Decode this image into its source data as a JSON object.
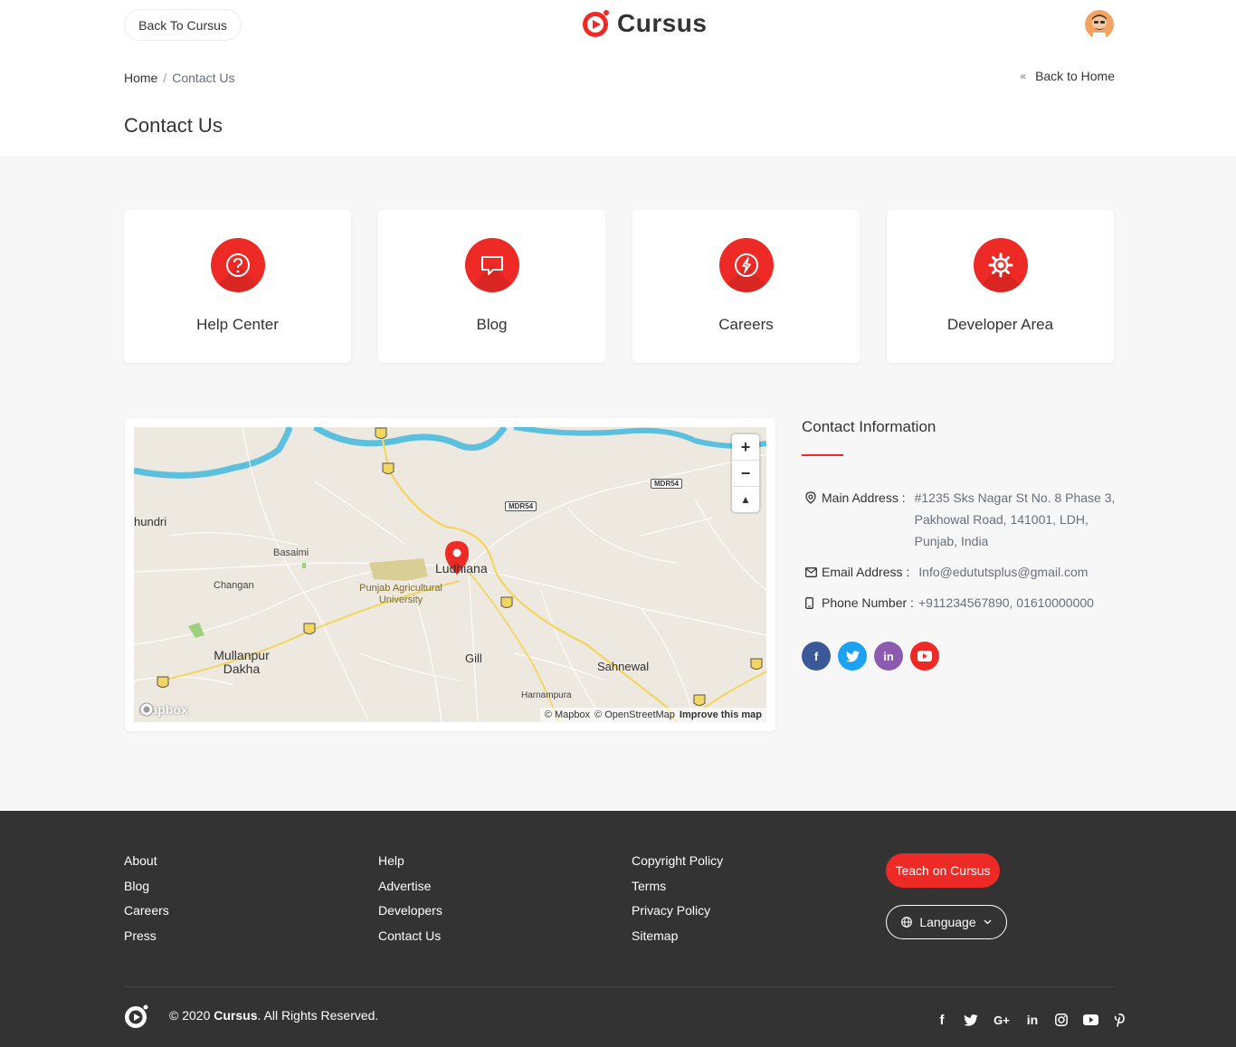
{
  "header": {
    "back_label": "Back To Cursus",
    "logo_text": "Cursus"
  },
  "breadcrumb": {
    "home": "Home",
    "separator": "/",
    "current": "Contact Us"
  },
  "back_home": {
    "arrows": "«",
    "label": "Back to Home"
  },
  "page_title": "Contact Us",
  "cards": [
    {
      "label": "Help Center",
      "icon": "question-icon"
    },
    {
      "label": "Blog",
      "icon": "comment-icon"
    },
    {
      "label": "Careers",
      "icon": "lightning-icon"
    },
    {
      "label": "Developer Area",
      "icon": "gear-icon"
    }
  ],
  "map": {
    "labels": {
      "ludhiana": "Ludhiana",
      "hundri": "hundri",
      "basaimi": "Basaimi",
      "changan": "Changan",
      "university": "Punjab Agricultural University",
      "mullanpur": "Mullanpur Dakha",
      "gill": "Gill",
      "sahnewal": "Sahnewal",
      "harnampura": "Harnampura"
    },
    "road_badges": [
      "44",
      "44",
      "MDR54",
      "MDR54",
      "44",
      "5",
      "5",
      "5",
      "5"
    ],
    "attribution_mapbox": "© Mapbox",
    "attribution_osm": "© OpenStreetMap",
    "improve": "Improve this map",
    "logo": "mapbox",
    "zoom_in": "+",
    "zoom_out": "−",
    "compass": "▲"
  },
  "contact": {
    "title": "Contact Information",
    "address_label": "Main Address :",
    "address_value": "#1235 Sks Nagar St No. 8 Phase 3, Pakhowal Road, 141001, LDH, Punjab, India",
    "email_label": "Email Address :",
    "email_value": "Info@edututsplus@gmail.com",
    "phone_label": "Phone Number :",
    "phone_value": "+911234567890, 01610000000",
    "socials": [
      {
        "name": "facebook",
        "glyph": "f",
        "color": "#3b5998"
      },
      {
        "name": "twitter",
        "glyph": "t",
        "color": "#1da1f2"
      },
      {
        "name": "linkedin",
        "glyph": "in",
        "color": "#8c5bb0"
      },
      {
        "name": "youtube",
        "glyph": "▶",
        "color": "#ed2a26"
      }
    ]
  },
  "footer": {
    "col1": [
      "About",
      "Blog",
      "Careers",
      "Press"
    ],
    "col2": [
      "Help",
      "Advertise",
      "Developers",
      "Contact Us"
    ],
    "col3": [
      "Copyright Policy",
      "Terms",
      "Privacy Policy",
      "Sitemap"
    ],
    "teach_label": "Teach on Cursus",
    "language_label": "Language",
    "copyright_prefix": "© 2020 ",
    "copyright_brand": "Cursus",
    "copyright_suffix": ". All Rights Reserved.",
    "social_icons": [
      "facebook-icon",
      "twitter-icon",
      "google-plus-icon",
      "linkedin-icon",
      "instagram-icon",
      "youtube-icon",
      "pinterest-icon"
    ]
  },
  "colors": {
    "accent": "#ed2a26",
    "footer_bg": "#333333",
    "page_bg": "#f7f7f7"
  }
}
